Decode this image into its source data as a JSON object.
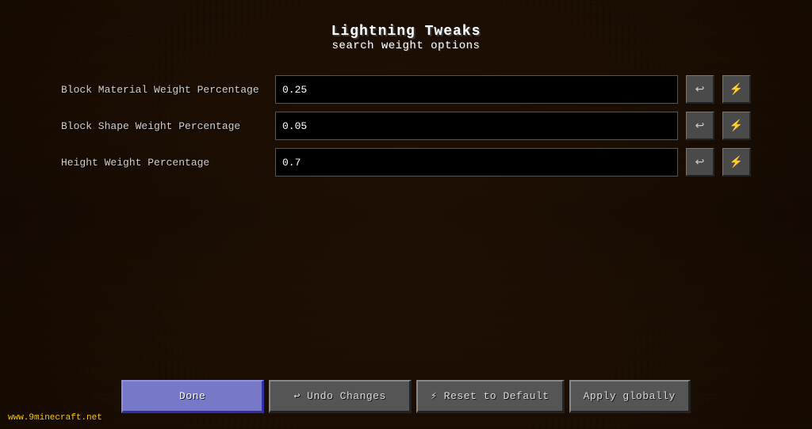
{
  "page": {
    "title_main": "Lightning Tweaks",
    "title_sub": "search weight options"
  },
  "settings": {
    "rows": [
      {
        "label": "Block Material Weight Percentage",
        "value": "0.25",
        "undo_icon": "↩",
        "reset_icon": "⚡"
      },
      {
        "label": "Block Shape Weight Percentage",
        "value": "0.05",
        "undo_icon": "↩",
        "reset_icon": "⚡"
      },
      {
        "label": "Height Weight Percentage",
        "value": "0.7",
        "undo_icon": "↩",
        "reset_icon": "⚡"
      }
    ]
  },
  "buttons": {
    "done": "Done",
    "undo_changes": "↩ Undo Changes",
    "reset_to_default": "⚡ Reset to Default",
    "apply_globally": "Apply globally"
  },
  "watermark": {
    "prefix": "www.",
    "brand": "9minecraft",
    "suffix": ".net"
  }
}
